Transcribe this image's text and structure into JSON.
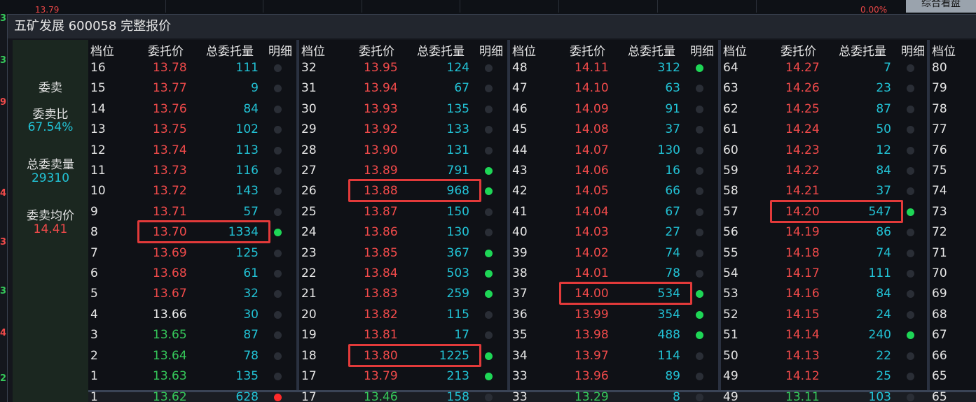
{
  "background": {
    "price": "13.79",
    "pct": "0.00%",
    "button": "综合看盘"
  },
  "left_edge_digits": [
    "3",
    "3",
    "9",
    "4",
    "3",
    "3",
    "4",
    "2"
  ],
  "window": {
    "title": "五矿发展 600058 完整报价"
  },
  "summary": {
    "sell_label": "委卖",
    "ratio_label": "委卖比",
    "ratio_value": "67.54%",
    "total_label": "总委卖量",
    "total_value": "29310",
    "avg_label": "委卖均价",
    "avg_value": "14.41"
  },
  "headers": [
    "档位",
    "委托价",
    "总委托量",
    "明细"
  ],
  "columns": [
    {
      "rows": [
        {
          "level": "16",
          "price": "13.78",
          "qty": "111",
          "dot": "off",
          "color": "red"
        },
        {
          "level": "15",
          "price": "13.77",
          "qty": "9",
          "dot": "off",
          "color": "red"
        },
        {
          "level": "14",
          "price": "13.76",
          "qty": "84",
          "dot": "off",
          "color": "red"
        },
        {
          "level": "13",
          "price": "13.75",
          "qty": "102",
          "dot": "off",
          "color": "red"
        },
        {
          "level": "12",
          "price": "13.74",
          "qty": "113",
          "dot": "off",
          "color": "red"
        },
        {
          "level": "11",
          "price": "13.73",
          "qty": "116",
          "dot": "off",
          "color": "red"
        },
        {
          "level": "10",
          "price": "13.72",
          "qty": "143",
          "dot": "off",
          "color": "red"
        },
        {
          "level": "9",
          "price": "13.71",
          "qty": "57",
          "dot": "off",
          "color": "red"
        },
        {
          "level": "8",
          "price": "13.70",
          "qty": "1334",
          "dot": "green",
          "color": "red"
        },
        {
          "level": "7",
          "price": "13.69",
          "qty": "125",
          "dot": "off",
          "color": "red"
        },
        {
          "level": "6",
          "price": "13.68",
          "qty": "61",
          "dot": "off",
          "color": "red"
        },
        {
          "level": "5",
          "price": "13.67",
          "qty": "32",
          "dot": "off",
          "color": "red"
        },
        {
          "level": "4",
          "price": "13.66",
          "qty": "30",
          "dot": "off",
          "color": "white"
        },
        {
          "level": "3",
          "price": "13.65",
          "qty": "87",
          "dot": "off",
          "color": "green"
        },
        {
          "level": "2",
          "price": "13.64",
          "qty": "78",
          "dot": "off",
          "color": "green"
        },
        {
          "level": "1",
          "price": "13.63",
          "qty": "135",
          "dot": "off",
          "color": "green"
        }
      ],
      "bottom": {
        "level": "1",
        "price": "13.62",
        "qty": "628",
        "dot": "red",
        "color": "green"
      }
    },
    {
      "rows": [
        {
          "level": "32",
          "price": "13.95",
          "qty": "124",
          "dot": "off",
          "color": "red"
        },
        {
          "level": "31",
          "price": "13.94",
          "qty": "67",
          "dot": "off",
          "color": "red"
        },
        {
          "level": "30",
          "price": "13.93",
          "qty": "135",
          "dot": "off",
          "color": "red"
        },
        {
          "level": "29",
          "price": "13.92",
          "qty": "133",
          "dot": "off",
          "color": "red"
        },
        {
          "level": "28",
          "price": "13.90",
          "qty": "131",
          "dot": "off",
          "color": "red"
        },
        {
          "level": "27",
          "price": "13.89",
          "qty": "791",
          "dot": "green",
          "color": "red"
        },
        {
          "level": "26",
          "price": "13.88",
          "qty": "968",
          "dot": "green",
          "color": "red"
        },
        {
          "level": "25",
          "price": "13.87",
          "qty": "150",
          "dot": "off",
          "color": "red"
        },
        {
          "level": "24",
          "price": "13.86",
          "qty": "130",
          "dot": "off",
          "color": "red"
        },
        {
          "level": "23",
          "price": "13.85",
          "qty": "367",
          "dot": "green",
          "color": "red"
        },
        {
          "level": "22",
          "price": "13.84",
          "qty": "503",
          "dot": "green",
          "color": "red"
        },
        {
          "level": "21",
          "price": "13.83",
          "qty": "259",
          "dot": "green",
          "color": "red"
        },
        {
          "level": "20",
          "price": "13.82",
          "qty": "115",
          "dot": "off",
          "color": "red"
        },
        {
          "level": "19",
          "price": "13.81",
          "qty": "17",
          "dot": "off",
          "color": "red"
        },
        {
          "level": "18",
          "price": "13.80",
          "qty": "1225",
          "dot": "green",
          "color": "red"
        },
        {
          "level": "17",
          "price": "13.79",
          "qty": "213",
          "dot": "green",
          "color": "red"
        }
      ],
      "bottom": {
        "level": "17",
        "price": "13.46",
        "qty": "158",
        "dot": "off",
        "color": "green"
      }
    },
    {
      "rows": [
        {
          "level": "48",
          "price": "14.11",
          "qty": "312",
          "dot": "green",
          "color": "red"
        },
        {
          "level": "47",
          "price": "14.10",
          "qty": "63",
          "dot": "off",
          "color": "red"
        },
        {
          "level": "46",
          "price": "14.09",
          "qty": "91",
          "dot": "off",
          "color": "red"
        },
        {
          "level": "45",
          "price": "14.08",
          "qty": "37",
          "dot": "off",
          "color": "red"
        },
        {
          "level": "44",
          "price": "14.07",
          "qty": "130",
          "dot": "off",
          "color": "red"
        },
        {
          "level": "43",
          "price": "14.06",
          "qty": "16",
          "dot": "off",
          "color": "red"
        },
        {
          "level": "42",
          "price": "14.05",
          "qty": "66",
          "dot": "off",
          "color": "red"
        },
        {
          "level": "41",
          "price": "14.04",
          "qty": "67",
          "dot": "off",
          "color": "red"
        },
        {
          "level": "40",
          "price": "14.03",
          "qty": "27",
          "dot": "off",
          "color": "red"
        },
        {
          "level": "39",
          "price": "14.02",
          "qty": "74",
          "dot": "off",
          "color": "red"
        },
        {
          "level": "38",
          "price": "14.01",
          "qty": "78",
          "dot": "off",
          "color": "red"
        },
        {
          "level": "37",
          "price": "14.00",
          "qty": "534",
          "dot": "green",
          "color": "red"
        },
        {
          "level": "36",
          "price": "13.99",
          "qty": "354",
          "dot": "green",
          "color": "red"
        },
        {
          "level": "35",
          "price": "13.98",
          "qty": "488",
          "dot": "green",
          "color": "red"
        },
        {
          "level": "34",
          "price": "13.97",
          "qty": "114",
          "dot": "off",
          "color": "red"
        },
        {
          "level": "33",
          "price": "13.96",
          "qty": "89",
          "dot": "off",
          "color": "red"
        }
      ],
      "bottom": {
        "level": "33",
        "price": "13.29",
        "qty": "8",
        "dot": "off",
        "color": "green"
      }
    },
    {
      "rows": [
        {
          "level": "64",
          "price": "14.27",
          "qty": "7",
          "dot": "off",
          "color": "red"
        },
        {
          "level": "63",
          "price": "14.26",
          "qty": "23",
          "dot": "off",
          "color": "red"
        },
        {
          "level": "62",
          "price": "14.25",
          "qty": "87",
          "dot": "off",
          "color": "red"
        },
        {
          "level": "61",
          "price": "14.24",
          "qty": "50",
          "dot": "off",
          "color": "red"
        },
        {
          "level": "60",
          "price": "14.23",
          "qty": "12",
          "dot": "off",
          "color": "red"
        },
        {
          "level": "59",
          "price": "14.22",
          "qty": "84",
          "dot": "off",
          "color": "red"
        },
        {
          "level": "58",
          "price": "14.21",
          "qty": "37",
          "dot": "off",
          "color": "red"
        },
        {
          "level": "57",
          "price": "14.20",
          "qty": "547",
          "dot": "green",
          "color": "red"
        },
        {
          "level": "56",
          "price": "14.19",
          "qty": "86",
          "dot": "off",
          "color": "red"
        },
        {
          "level": "55",
          "price": "14.18",
          "qty": "74",
          "dot": "off",
          "color": "red"
        },
        {
          "level": "54",
          "price": "14.17",
          "qty": "111",
          "dot": "off",
          "color": "red"
        },
        {
          "level": "53",
          "price": "14.16",
          "qty": "84",
          "dot": "off",
          "color": "red"
        },
        {
          "level": "52",
          "price": "14.15",
          "qty": "24",
          "dot": "off",
          "color": "red"
        },
        {
          "level": "51",
          "price": "14.14",
          "qty": "240",
          "dot": "green",
          "color": "red"
        },
        {
          "level": "50",
          "price": "14.13",
          "qty": "22",
          "dot": "off",
          "color": "red"
        },
        {
          "level": "49",
          "price": "14.12",
          "qty": "25",
          "dot": "off",
          "color": "red"
        }
      ],
      "bottom": {
        "level": "49",
        "price": "13.11",
        "qty": "103",
        "dot": "off",
        "color": "green"
      }
    },
    {
      "rows": [
        {
          "level": "80"
        },
        {
          "level": "79"
        },
        {
          "level": "78"
        },
        {
          "level": "77"
        },
        {
          "level": "76"
        },
        {
          "level": "75"
        },
        {
          "level": "74"
        },
        {
          "level": "73"
        },
        {
          "level": "72"
        },
        {
          "level": "71"
        },
        {
          "level": "70"
        },
        {
          "level": "69"
        },
        {
          "level": "68"
        },
        {
          "level": "67"
        },
        {
          "level": "66"
        },
        {
          "level": "65"
        }
      ],
      "bottom": {
        "level": "65"
      }
    }
  ],
  "highlights": [
    {
      "column": 0,
      "row": 8
    },
    {
      "column": 1,
      "row": 6
    },
    {
      "column": 1,
      "row": 14
    },
    {
      "column": 2,
      "row": 11
    },
    {
      "column": 3,
      "row": 7
    }
  ]
}
